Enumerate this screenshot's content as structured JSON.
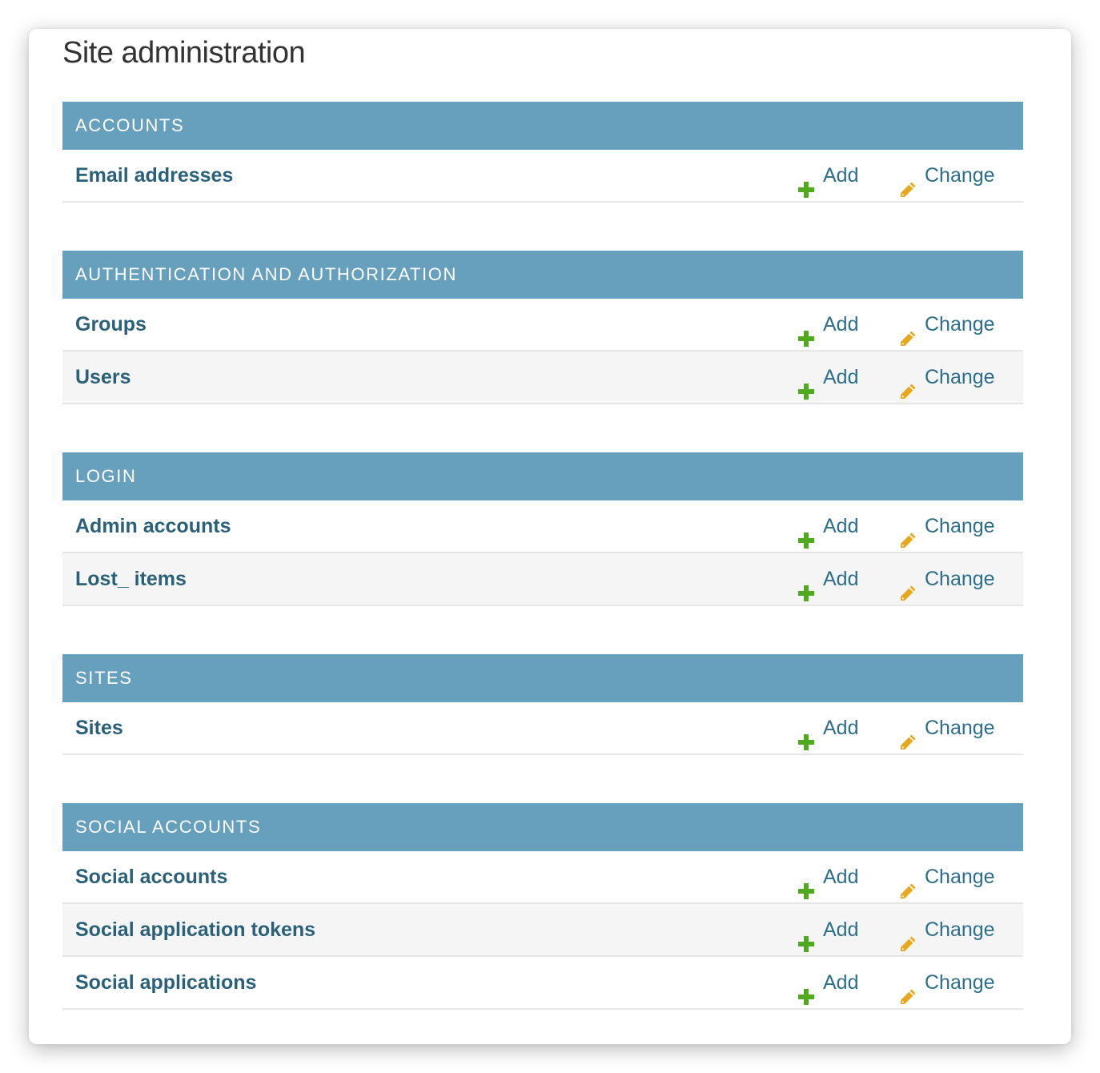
{
  "page": {
    "title": "Site administration"
  },
  "colors": {
    "header_bg": "#67a0bc",
    "link": "#2a6179",
    "add_icon": "#4faa1f",
    "change_icon": "#e7a81e"
  },
  "actions": {
    "add_label": "Add",
    "change_label": "Change",
    "add_icon": "plus-icon",
    "change_icon": "pencil-icon"
  },
  "modules": [
    {
      "name": "ACCOUNTS",
      "models": [
        {
          "name": "Email addresses"
        }
      ]
    },
    {
      "name": "AUTHENTICATION AND AUTHORIZATION",
      "models": [
        {
          "name": "Groups"
        },
        {
          "name": "Users"
        }
      ]
    },
    {
      "name": "LOGIN",
      "models": [
        {
          "name": "Admin accounts"
        },
        {
          "name": "Lost_ items"
        }
      ]
    },
    {
      "name": "SITES",
      "models": [
        {
          "name": "Sites"
        }
      ]
    },
    {
      "name": "SOCIAL ACCOUNTS",
      "models": [
        {
          "name": "Social accounts"
        },
        {
          "name": "Social application tokens"
        },
        {
          "name": "Social applications"
        }
      ]
    }
  ]
}
